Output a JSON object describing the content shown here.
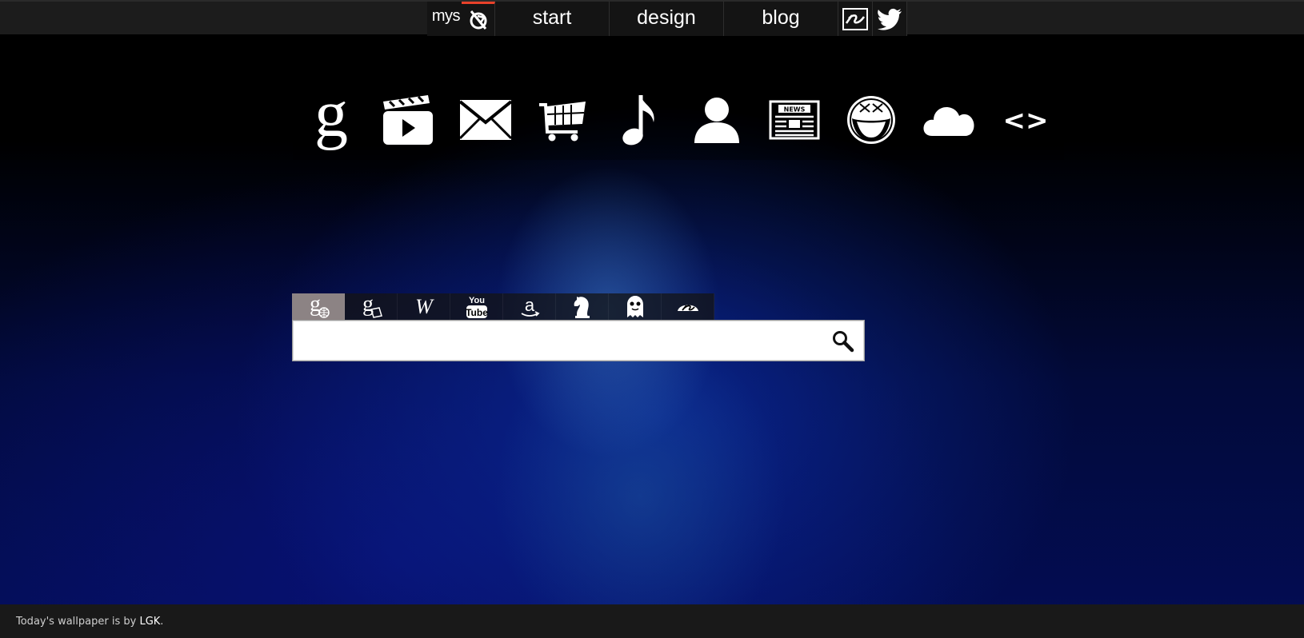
{
  "nav": {
    "logo_text": "mys",
    "links": [
      {
        "label": "start"
      },
      {
        "label": "design"
      },
      {
        "label": "blog"
      }
    ],
    "accent_color": "#e8412a"
  },
  "quick_launch": [
    {
      "icon": "google-icon"
    },
    {
      "icon": "video-icon"
    },
    {
      "icon": "mail-icon"
    },
    {
      "icon": "cart-icon"
    },
    {
      "icon": "music-icon"
    },
    {
      "icon": "person-icon"
    },
    {
      "icon": "news-icon",
      "text": "NEWS"
    },
    {
      "icon": "laughing-face-icon"
    },
    {
      "icon": "cloud-icon"
    },
    {
      "icon": "code-icon",
      "text": "<>"
    }
  ],
  "search": {
    "engines": [
      {
        "icon": "google-web-icon",
        "active": true
      },
      {
        "icon": "google-images-icon"
      },
      {
        "icon": "wikipedia-icon",
        "text": "W"
      },
      {
        "icon": "youtube-icon",
        "text_top": "You",
        "text_bottom": "Tube"
      },
      {
        "icon": "amazon-icon",
        "text": "a"
      },
      {
        "icon": "chess-knight-icon"
      },
      {
        "icon": "ghost-icon"
      },
      {
        "icon": "deviantart-icon"
      }
    ],
    "active_tab_color": "#8c8384",
    "value": "",
    "placeholder": ""
  },
  "footer": {
    "text_before": "Today's wallpaper is by ",
    "author": "LGK",
    "text_after": "."
  }
}
